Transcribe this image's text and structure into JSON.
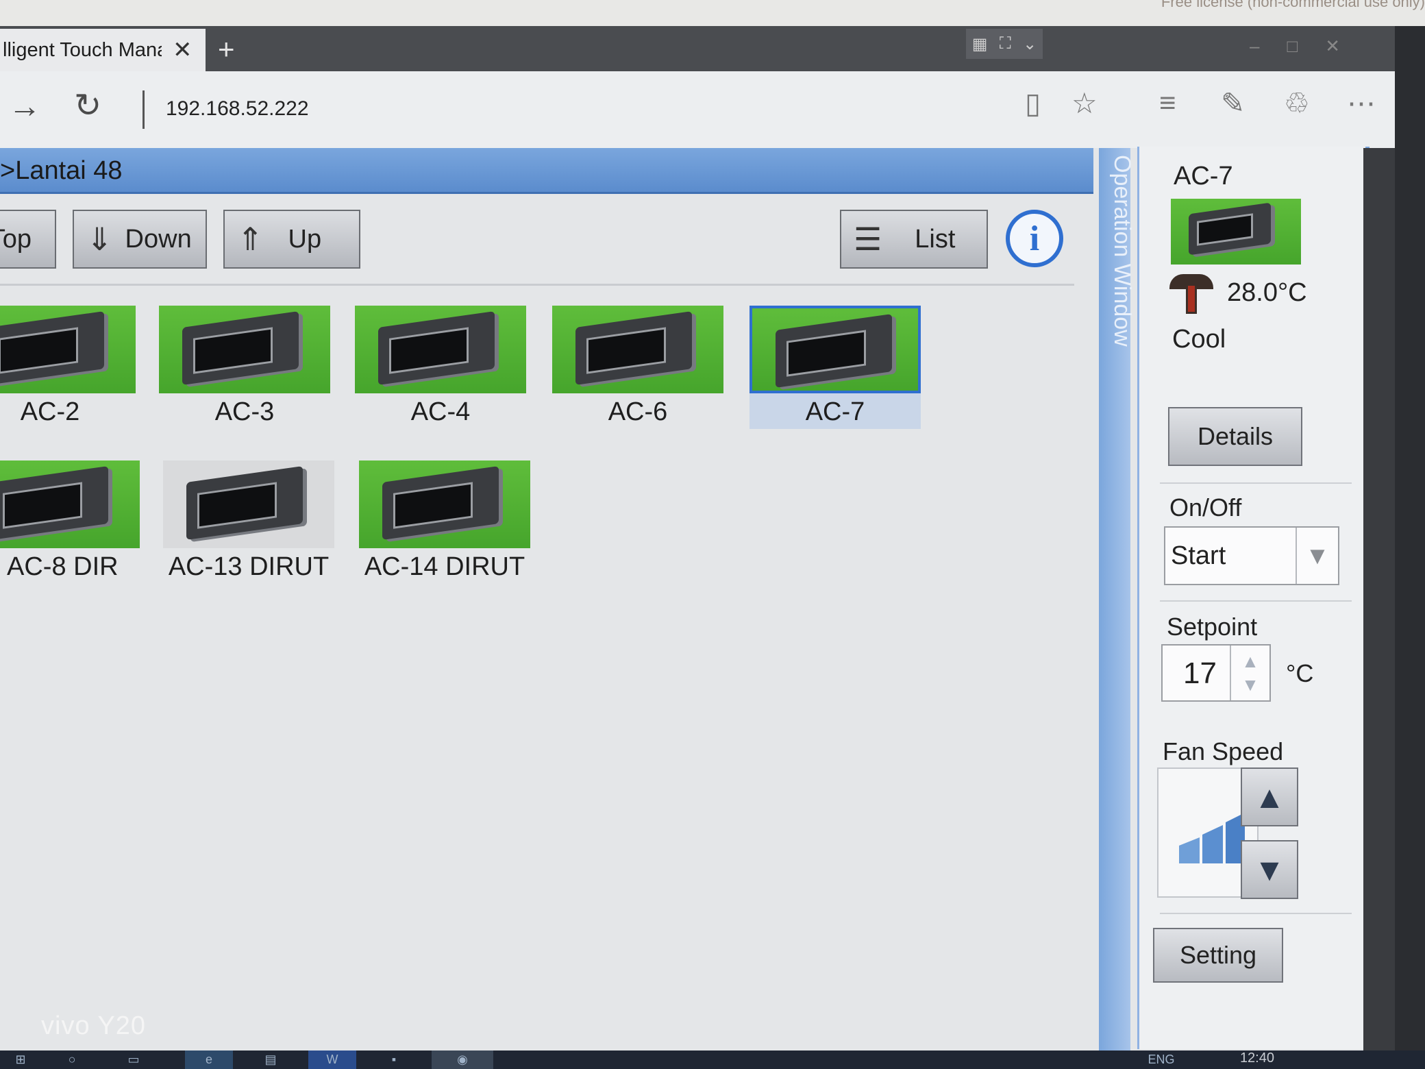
{
  "browser": {
    "license_text": "Free license (non-commercial use only)",
    "tab_title": "lligent Touch Manag",
    "tab_close": "✕",
    "new_tab": "+",
    "address": "192.168.52.222"
  },
  "header": {
    "breadcrumb": ">Lantai 48"
  },
  "toolbar": {
    "top_label": "Top",
    "down_label": "Down",
    "up_label": "Up",
    "list_label": "List",
    "info_label": "i"
  },
  "units": [
    {
      "name": "AC-2",
      "status": "on"
    },
    {
      "name": "AC-3",
      "status": "on"
    },
    {
      "name": "AC-4",
      "status": "on"
    },
    {
      "name": "AC-6",
      "status": "on"
    },
    {
      "name": "AC-7",
      "status": "on",
      "selected": true
    },
    {
      "name": "AC-8 DIR",
      "status": "on"
    },
    {
      "name": "AC-13 DIRUT",
      "status": "off"
    },
    {
      "name": "AC-14 DIRUT",
      "status": "on"
    }
  ],
  "operation_window": {
    "label": "Operation Window",
    "unit_name": "AC-7",
    "room_temp": "28.0°C",
    "mode": "Cool",
    "details_label": "Details",
    "onoff_label": "On/Off",
    "onoff_value": "Start",
    "setpoint_label": "Setpoint",
    "setpoint_value": "17",
    "setpoint_unit": "°C",
    "fan_speed_label": "Fan Speed",
    "setting_label": "Setting"
  },
  "taskbar": {
    "clock": "12:40",
    "lang": "ENG"
  },
  "watermark": "vivo Y20",
  "colors": {
    "unit_on": "#4fb032",
    "unit_off": "#d9dadc",
    "selected_border": "#2f6fd0",
    "header_blue": "#5b8ccd"
  }
}
